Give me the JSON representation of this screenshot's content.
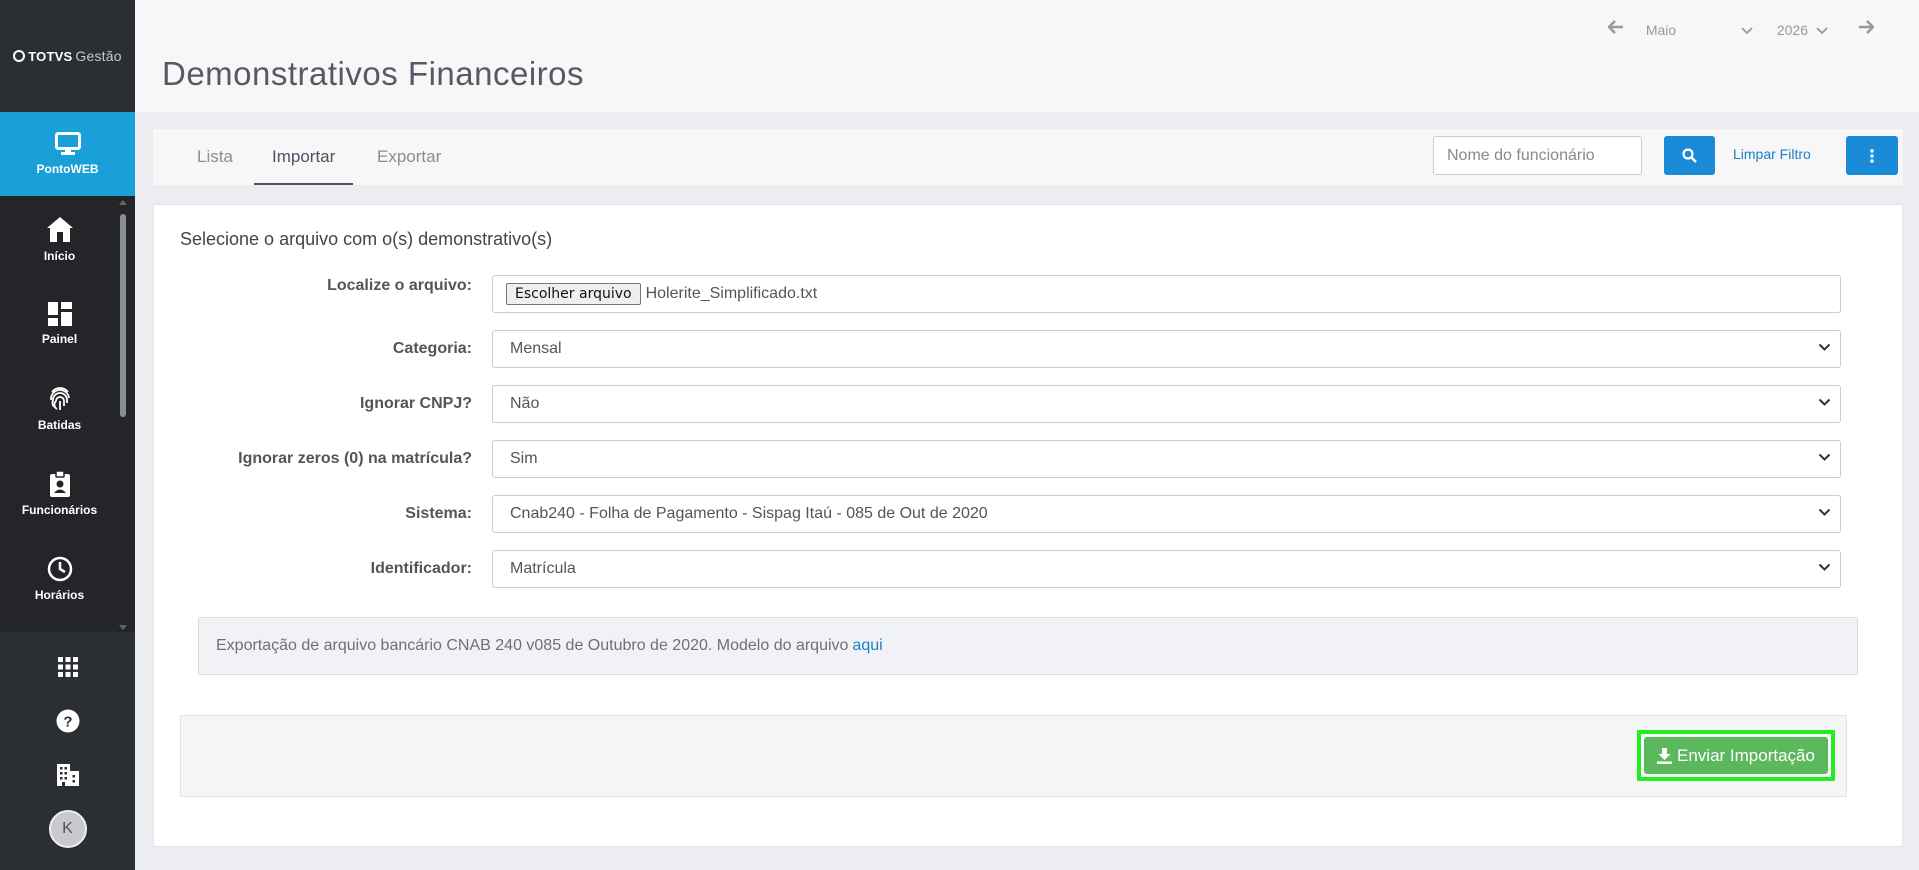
{
  "logo": {
    "brand": "TOTVS",
    "product": "Gestão"
  },
  "sidebar": {
    "app_label": "PontoWEB",
    "items": [
      {
        "label": "Início",
        "icon": "home-icon"
      },
      {
        "label": "Painel",
        "icon": "dashboard-icon"
      },
      {
        "label": "Batidas",
        "icon": "fingerprint-icon"
      },
      {
        "label": "Funcionários",
        "icon": "badge-icon"
      },
      {
        "label": "Horários",
        "icon": "clock-icon"
      }
    ],
    "bottom": {
      "avatar": "K"
    }
  },
  "header": {
    "title": "Demonstrativos Financeiros",
    "month": "Maio",
    "year": "2026"
  },
  "tabs": [
    {
      "label": "Lista"
    },
    {
      "label": "Importar"
    },
    {
      "label": "Exportar"
    }
  ],
  "toolbar": {
    "search_placeholder": "Nome do funcionário",
    "clear_filter": "Limpar Filtro"
  },
  "form": {
    "title": "Selecione o arquivo com o(s) demonstrativo(s)",
    "file": {
      "label": "Localize o arquivo:",
      "button": "Escolher arquivo",
      "value": "Holerite_Simplificado.txt"
    },
    "categoria": {
      "label": "Categoria:",
      "value": "Mensal"
    },
    "ignorar_cnpj": {
      "label": "Ignorar CNPJ?",
      "value": "Não"
    },
    "ignorar_zeros": {
      "label": "Ignorar zeros (0) na matrícula?",
      "value": "Sim"
    },
    "sistema": {
      "label": "Sistema:",
      "value": "Cnab240 - Folha de Pagamento - Sispag Itaú - 085 de Out de 2020"
    },
    "identificador": {
      "label": "Identificador:",
      "value": "Matrícula"
    },
    "info_text": "Exportação de arquivo bancário CNAB 240 v085 de Outubro de 2020. Modelo do arquivo",
    "info_link": "aqui",
    "submit": "Enviar Importação"
  },
  "colors": {
    "accent": "#1a9fd8",
    "success": "#5cb85c",
    "sidebar": "#2b2e33"
  }
}
